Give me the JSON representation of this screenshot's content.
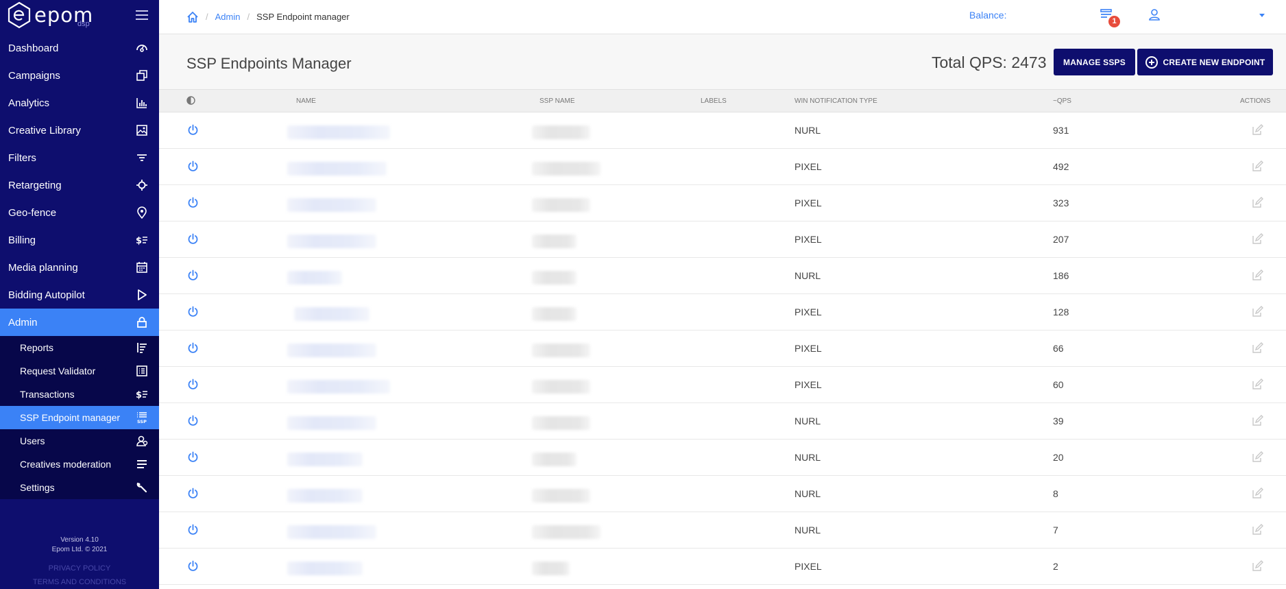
{
  "sidebar": {
    "logo_text": "epom",
    "logo_sub": "dsp",
    "nav": [
      {
        "label": "Dashboard",
        "icon": "dashboard-gauge-icon"
      },
      {
        "label": "Campaigns",
        "icon": "campaigns-copy-icon"
      },
      {
        "label": "Analytics",
        "icon": "analytics-bar-chart-icon"
      },
      {
        "label": "Creative Library",
        "icon": "image-icon"
      },
      {
        "label": "Filters",
        "icon": "filter-icon"
      },
      {
        "label": "Retargeting",
        "icon": "crosshair-icon"
      },
      {
        "label": "Geo-fence",
        "icon": "location-pin-icon"
      },
      {
        "label": "Billing",
        "icon": "billing-dollar-icon"
      },
      {
        "label": "Media planning",
        "icon": "calendar-icon"
      },
      {
        "label": "Bidding Autopilot",
        "icon": "play-icon"
      },
      {
        "label": "Admin",
        "icon": "lock-icon",
        "active": true
      }
    ],
    "subnav": [
      {
        "label": "Reports",
        "icon": "reports-icon"
      },
      {
        "label": "Request Validator",
        "icon": "validator-list-icon"
      },
      {
        "label": "Transactions",
        "icon": "transactions-dollar-icon"
      },
      {
        "label": "SSP Endpoint manager",
        "icon": "ssp-list-icon",
        "active": true
      },
      {
        "label": "Users",
        "icon": "users-icon"
      },
      {
        "label": "Creatives moderation",
        "icon": "moderation-lines-icon"
      },
      {
        "label": "Settings",
        "icon": "wrench-icon"
      }
    ],
    "version": "Version 4.10",
    "copyright": "Epom Ltd. © 2021",
    "privacy": "PRIVACY POLICY",
    "terms": "TERMS AND CONDITIONS"
  },
  "topbar": {
    "crumb_admin": "Admin",
    "crumb_current": "SSP Endpoint manager",
    "balance_label": "Balance:",
    "notification_count": "1"
  },
  "page": {
    "title": "SSP Endpoints Manager",
    "total_qps": "Total QPS: 2473",
    "manage_button": "MANAGE SSPS",
    "create_button": "CREATE NEW ENDPOINT"
  },
  "table": {
    "headers": {
      "name": "NAME",
      "ssp_name": "SSP NAME",
      "labels": "LABELS",
      "win_type": "WIN NOTIFICATION TYPE",
      "qps": "~QPS",
      "actions": "ACTIONS"
    },
    "rows": [
      {
        "win_type": "NURL",
        "qps": "931"
      },
      {
        "win_type": "PIXEL",
        "qps": "492"
      },
      {
        "win_type": "PIXEL",
        "qps": "323"
      },
      {
        "win_type": "PIXEL",
        "qps": "207"
      },
      {
        "win_type": "NURL",
        "qps": "186"
      },
      {
        "win_type": "PIXEL",
        "qps": "128"
      },
      {
        "win_type": "PIXEL",
        "qps": "66"
      },
      {
        "win_type": "PIXEL",
        "qps": "60"
      },
      {
        "win_type": "NURL",
        "qps": "39"
      },
      {
        "win_type": "NURL",
        "qps": "20"
      },
      {
        "win_type": "NURL",
        "qps": "8"
      },
      {
        "win_type": "NURL",
        "qps": "7"
      },
      {
        "win_type": "PIXEL",
        "qps": "2"
      }
    ]
  },
  "colors": {
    "sidebar_bg": "#0e0e6e",
    "submenu_bg": "#07074a",
    "accent": "#3b82f6",
    "button_bg": "#0e0e6e",
    "badge": "#e74c3c"
  }
}
